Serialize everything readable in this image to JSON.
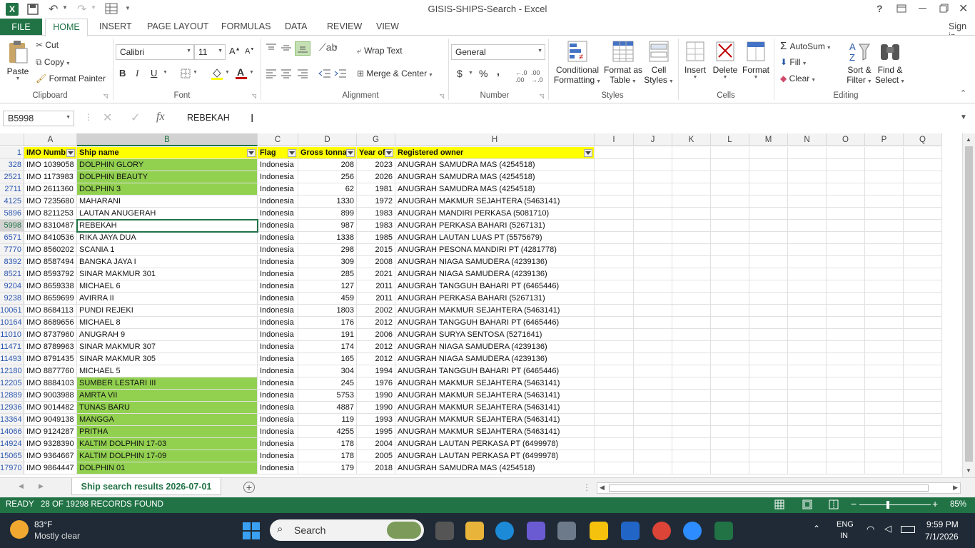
{
  "window": {
    "title": "GISIS-SHIPS-Search - Excel",
    "help": "?"
  },
  "ribbon_tabs": [
    "FILE",
    "HOME",
    "INSERT",
    "PAGE LAYOUT",
    "FORMULAS",
    "DATA",
    "REVIEW",
    "VIEW"
  ],
  "sign_in": "Sign in",
  "clipboard": {
    "paste": "Paste",
    "cut": "Cut",
    "copy": "Copy",
    "format_painter": "Format Painter",
    "label": "Clipboard"
  },
  "font": {
    "name": "Calibri",
    "size": "11",
    "bold": "B",
    "italic": "I",
    "underline": "U",
    "label": "Font"
  },
  "alignment": {
    "wrap": "Wrap Text",
    "merge": "Merge & Center",
    "label": "Alignment"
  },
  "number": {
    "format": "General",
    "label": "Number",
    "currency": "$",
    "percent": "%",
    "comma": ","
  },
  "styles": {
    "conditional": "Conditional",
    "conditional2": "Formatting",
    "format_as": "Format as",
    "format_as2": "Table",
    "cell_styles": "Cell",
    "cell_styles2": "Styles",
    "label": "Styles"
  },
  "cells": {
    "insert": "Insert",
    "delete": "Delete",
    "format": "Format",
    "label": "Cells"
  },
  "editing": {
    "autosum": "AutoSum",
    "fill": "Fill",
    "clear": "Clear",
    "sort": "Sort &",
    "sort2": "Filter",
    "find": "Find &",
    "find2": "Select",
    "label": "Editing"
  },
  "formula_bar": {
    "name_box": "B5998",
    "value": "REBEKAH",
    "fx": "fx"
  },
  "columns": [
    "A",
    "B",
    "C",
    "D",
    "G",
    "H",
    "I",
    "J",
    "K",
    "L",
    "M",
    "N",
    "O",
    "P",
    "Q"
  ],
  "headers": [
    "IMO Numb",
    "Ship name",
    "Flag",
    "Gross tonnag",
    "Year of",
    "Registered owner"
  ],
  "rows": [
    {
      "n": "328",
      "imo": "IMO 1039058",
      "ship": "DOLPHIN GLORY",
      "flag": "Indonesia",
      "gt": "208",
      "year": "2023",
      "owner": "ANUGRAH SAMUDRA MAS (4254518)",
      "hl": true
    },
    {
      "n": "2521",
      "imo": "IMO 1173983",
      "ship": "DOLPHIN BEAUTY",
      "flag": "Indonesia",
      "gt": "256",
      "year": "2026",
      "owner": "ANUGRAH SAMUDRA MAS (4254518)",
      "hl": true
    },
    {
      "n": "2711",
      "imo": "IMO 2611360",
      "ship": "DOLPHIN 3",
      "flag": "Indonesia",
      "gt": "62",
      "year": "1981",
      "owner": "ANUGRAH SAMUDRA MAS (4254518)",
      "hl": true
    },
    {
      "n": "4125",
      "imo": "IMO 7235680",
      "ship": "MAHARANI",
      "flag": "Indonesia",
      "gt": "1330",
      "year": "1972",
      "owner": "ANUGRAH MAKMUR SEJAHTERA (5463141)",
      "hl": false
    },
    {
      "n": "5896",
      "imo": "IMO 8211253",
      "ship": "LAUTAN ANUGERAH",
      "flag": "Indonesia",
      "gt": "899",
      "year": "1983",
      "owner": "ANUGRAH MANDIRI PERKASA (5081710)",
      "hl": false
    },
    {
      "n": "5998",
      "imo": "IMO 8310487",
      "ship": "REBEKAH",
      "flag": "Indonesia",
      "gt": "987",
      "year": "1983",
      "owner": "ANUGRAH PERKASA BAHARI (5267131)",
      "hl": false
    },
    {
      "n": "6571",
      "imo": "IMO 8410536",
      "ship": "RIKA JAYA DUA",
      "flag": "Indonesia",
      "gt": "1338",
      "year": "1985",
      "owner": "ANUGRAH LAUTAN LUAS PT (5575679)",
      "hl": false
    },
    {
      "n": "7770",
      "imo": "IMO 8560202",
      "ship": "SCANIA 1",
      "flag": "Indonesia",
      "gt": "298",
      "year": "2015",
      "owner": "ANUGRAH PESONA MANDIRI PT (4281778)",
      "hl": false
    },
    {
      "n": "8392",
      "imo": "IMO 8587494",
      "ship": "BANGKA JAYA I",
      "flag": "Indonesia",
      "gt": "309",
      "year": "2008",
      "owner": "ANUGRAH NIAGA SAMUDERA (4239136)",
      "hl": false
    },
    {
      "n": "8521",
      "imo": "IMO 8593792",
      "ship": "SINAR MAKMUR 301",
      "flag": "Indonesia",
      "gt": "285",
      "year": "2021",
      "owner": "ANUGRAH NIAGA SAMUDERA (4239136)",
      "hl": false
    },
    {
      "n": "9204",
      "imo": "IMO 8659338",
      "ship": "MICHAEL 6",
      "flag": "Indonesia",
      "gt": "127",
      "year": "2011",
      "owner": "ANUGRAH TANGGUH BAHARI PT (6465446)",
      "hl": false
    },
    {
      "n": "9238",
      "imo": "IMO 8659699",
      "ship": "AVIRRA II",
      "flag": "Indonesia",
      "gt": "459",
      "year": "2011",
      "owner": "ANUGRAH PERKASA BAHARI (5267131)",
      "hl": false
    },
    {
      "n": "10061",
      "imo": "IMO 8684113",
      "ship": "PUNDI REJEKI",
      "flag": "Indonesia",
      "gt": "1803",
      "year": "2002",
      "owner": "ANUGRAH MAKMUR SEJAHTERA (5463141)",
      "hl": false
    },
    {
      "n": "10164",
      "imo": "IMO 8689656",
      "ship": "MICHAEL 8",
      "flag": "Indonesia",
      "gt": "176",
      "year": "2012",
      "owner": "ANUGRAH TANGGUH BAHARI PT (6465446)",
      "hl": false
    },
    {
      "n": "11010",
      "imo": "IMO 8737960",
      "ship": "ANUGRAH 9",
      "flag": "Indonesia",
      "gt": "191",
      "year": "2006",
      "owner": "ANUGRAH SURYA SENTOSA (5271641)",
      "hl": false
    },
    {
      "n": "11471",
      "imo": "IMO 8789963",
      "ship": "SINAR MAKMUR 307",
      "flag": "Indonesia",
      "gt": "174",
      "year": "2012",
      "owner": "ANUGRAH NIAGA SAMUDERA (4239136)",
      "hl": false
    },
    {
      "n": "11493",
      "imo": "IMO 8791435",
      "ship": "SINAR MAKMUR 305",
      "flag": "Indonesia",
      "gt": "165",
      "year": "2012",
      "owner": "ANUGRAH NIAGA SAMUDERA (4239136)",
      "hl": false
    },
    {
      "n": "12180",
      "imo": "IMO 8877760",
      "ship": "MICHAEL 5",
      "flag": "Indonesia",
      "gt": "304",
      "year": "1994",
      "owner": "ANUGRAH TANGGUH BAHARI PT (6465446)",
      "hl": false
    },
    {
      "n": "12205",
      "imo": "IMO 8884103",
      "ship": "SUMBER LESTARI III",
      "flag": "Indonesia",
      "gt": "245",
      "year": "1976",
      "owner": "ANUGRAH MAKMUR SEJAHTERA (5463141)",
      "hl": true
    },
    {
      "n": "12889",
      "imo": "IMO 9003988",
      "ship": "AMRTA VII",
      "flag": "Indonesia",
      "gt": "5753",
      "year": "1990",
      "owner": "ANUGRAH MAKMUR SEJAHTERA (5463141)",
      "hl": true
    },
    {
      "n": "12936",
      "imo": "IMO 9014482",
      "ship": "TUNAS BARU",
      "flag": "Indonesia",
      "gt": "4887",
      "year": "1990",
      "owner": "ANUGRAH MAKMUR SEJAHTERA (5463141)",
      "hl": true
    },
    {
      "n": "13364",
      "imo": "IMO 9049138",
      "ship": "MANGGA",
      "flag": "Indonesia",
      "gt": "119",
      "year": "1993",
      "owner": "ANUGRAH MAKMUR SEJAHTERA (5463141)",
      "hl": true
    },
    {
      "n": "14066",
      "imo": "IMO 9124287",
      "ship": "PRITHA",
      "flag": "Indonesia",
      "gt": "4255",
      "year": "1995",
      "owner": "ANUGRAH MAKMUR SEJAHTERA (5463141)",
      "hl": true
    },
    {
      "n": "14924",
      "imo": "IMO 9328390",
      "ship": "KALTIM DOLPHIN 17-03",
      "flag": "Indonesia",
      "gt": "178",
      "year": "2004",
      "owner": "ANUGRAH LAUTAN PERKASA PT (6499978)",
      "hl": true
    },
    {
      "n": "15065",
      "imo": "IMO 9364667",
      "ship": "KALTIM DOLPHIN 17-09",
      "flag": "Indonesia",
      "gt": "178",
      "year": "2005",
      "owner": "ANUGRAH LAUTAN PERKASA PT (6499978)",
      "hl": true
    },
    {
      "n": "17970",
      "imo": "IMO 9864447",
      "ship": "DOLPHIN 01",
      "flag": "Indonesia",
      "gt": "179",
      "year": "2018",
      "owner": "ANUGRAH SAMUDRA MAS (4254518)",
      "hl": true
    }
  ],
  "sheet_tab": "Ship search results 2026-07-01",
  "status": {
    "mode": "READY",
    "records": "28 OF 19298 RECORDS FOUND",
    "zoom": "85%"
  },
  "taskbar": {
    "temp": "83°F",
    "weather": "Mostly clear",
    "search": "Search",
    "lang": "ENG",
    "region": "IN",
    "time": "9:59 PM",
    "date": "7/1/2026"
  },
  "colors": {
    "excel_green": "#217346",
    "header_yellow": "#ffff00",
    "highlight_green": "#92d050"
  }
}
